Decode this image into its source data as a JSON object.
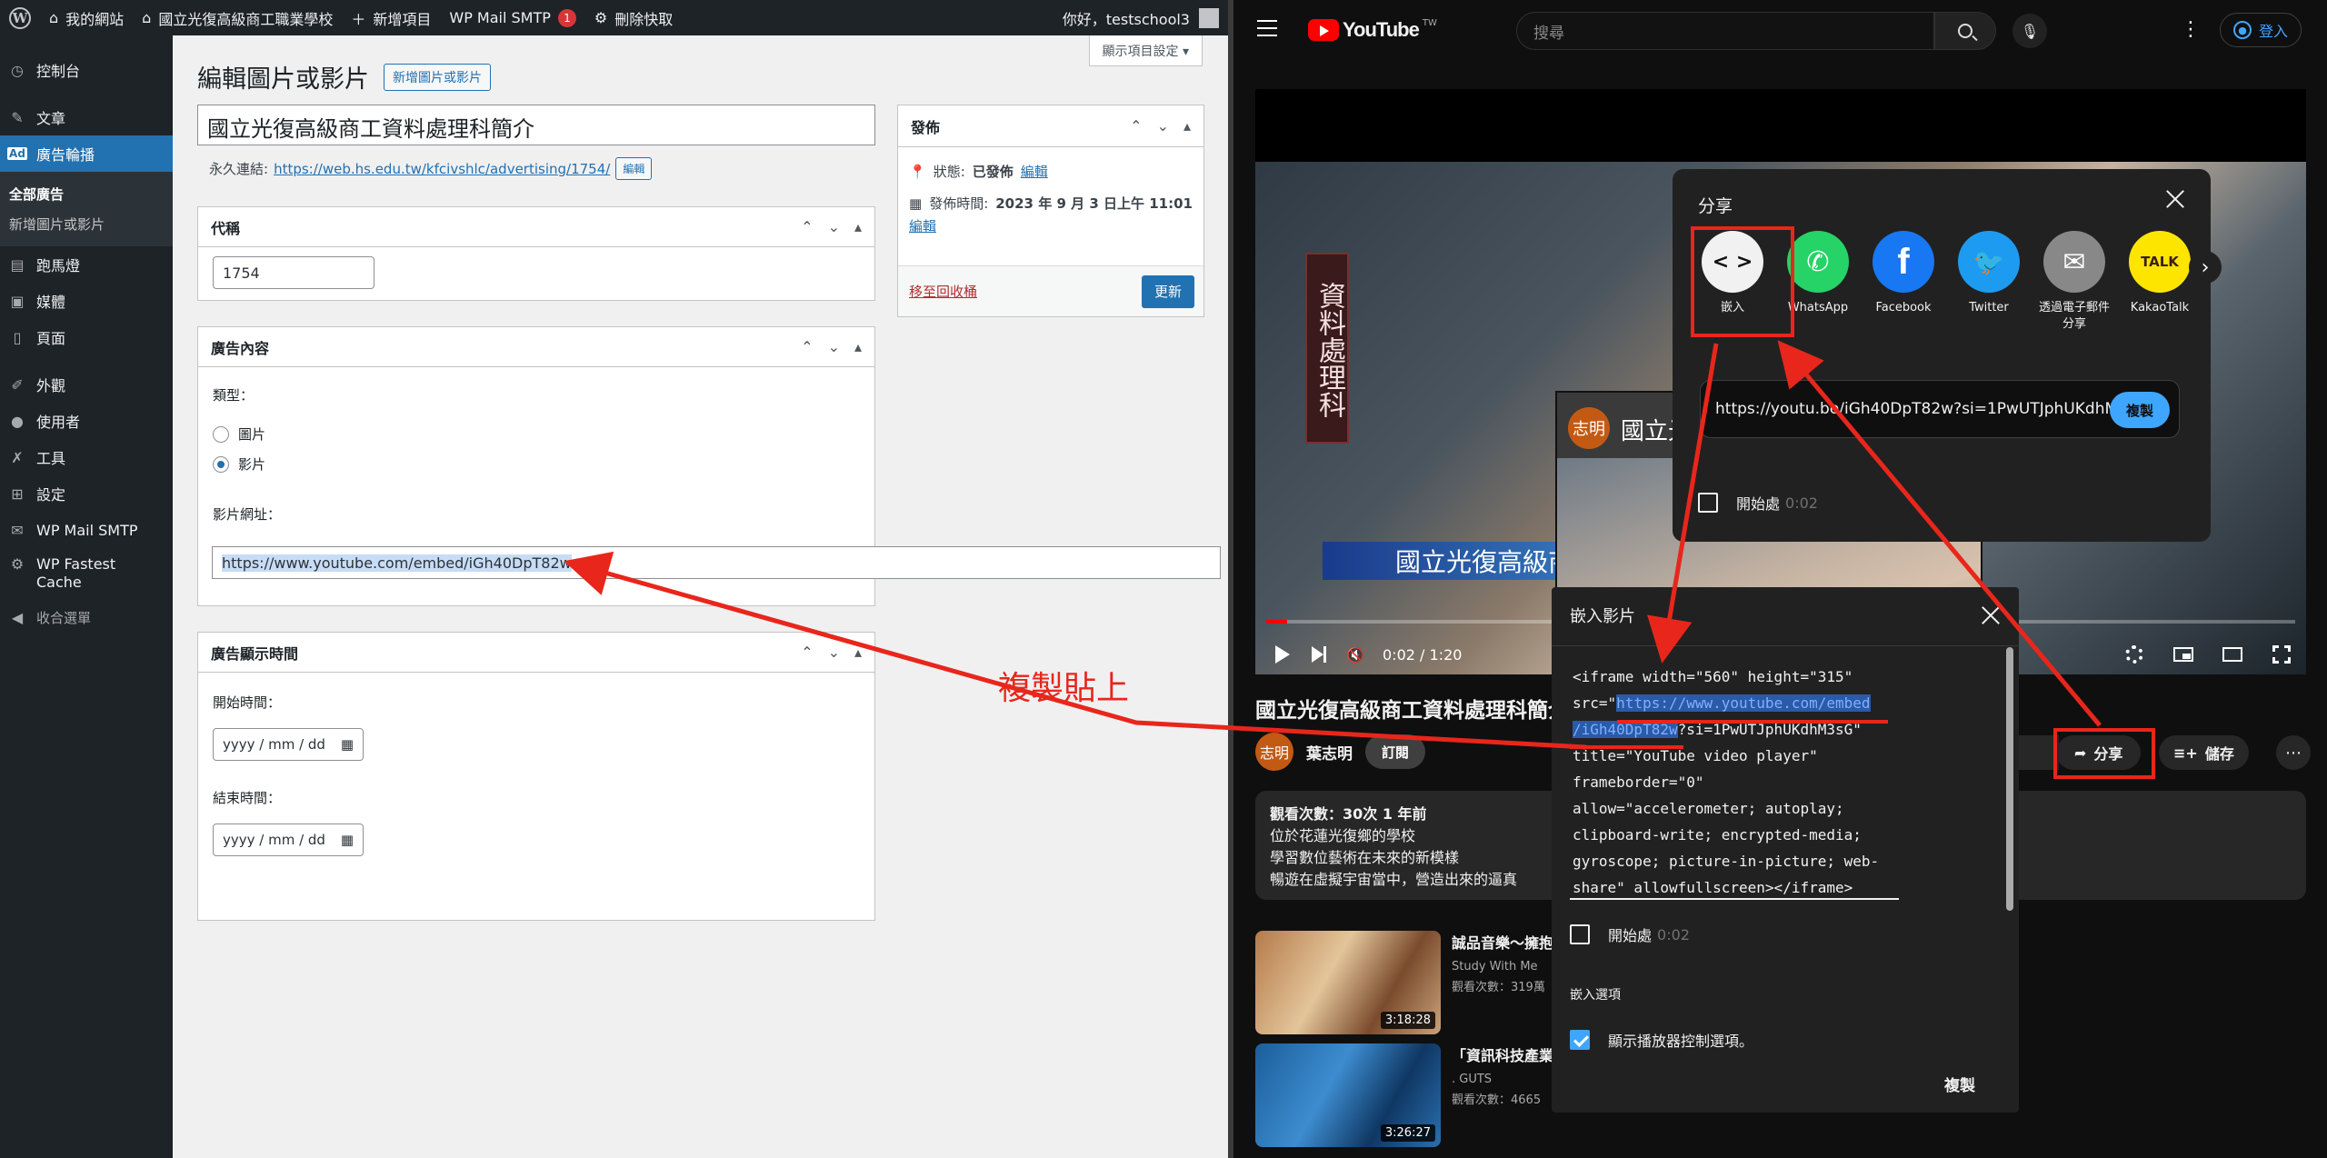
{
  "wp": {
    "adminbar": {
      "wp_logo": "W",
      "site": "我的網站",
      "school": "國立光復高級商工職業學校",
      "new": "新增項目",
      "smtp": "WP Mail SMTP",
      "smtp_count": "1",
      "cache": "刪除快取",
      "greeting": "你好，testschool3"
    },
    "sidebar": {
      "dashboard": "控制台",
      "posts": "文章",
      "ads_icon": "Ad",
      "ads": "廣告輪播",
      "all_ads": "全部廣告",
      "new_ad": "新增圖片或影片",
      "marquee": "跑馬燈",
      "media": "媒體",
      "pages": "頁面",
      "appearance": "外觀",
      "users": "使用者",
      "tools": "工具",
      "settings": "設定",
      "mail_smtp": "WP Mail SMTP",
      "fastest_cache": "WP Fastest Cache",
      "collapse": "收合選單"
    },
    "screen_options": "顯示項目設定 ▾",
    "page_title": "編輯圖片或影片",
    "add_new": "新增圖片或影片",
    "title_value": "國立光復高級商工資料處理科簡介",
    "permalink_label": "永久連結:",
    "permalink_url": "https://web.hs.edu.tw/kfcivshlc/advertising/1754/",
    "edit_btn": "編輯",
    "code_box": {
      "title": "代稱",
      "value": "1754"
    },
    "content_box": {
      "title": "廣告內容",
      "type_label": "類型：",
      "opt_image": "圖片",
      "opt_video": "影片",
      "url_label": "影片網址：",
      "url_value": "https://www.youtube.com/embed/iGh40DpT82w"
    },
    "time_box": {
      "title": "廣告顯示時間",
      "start_label": "開始時間：",
      "end_label": "結束時間：",
      "date_placeholder": "yyyy / mm / dd"
    },
    "publish_box": {
      "title": "發佈",
      "status_label": "狀態: ",
      "status_value": "已發佈",
      "status_edit": "編輯",
      "date_label": "發佈時間: ",
      "date_value": "2023 年 9 月 3 日上午 11:01",
      "date_edit": "編輯",
      "trash": "移至回收桶",
      "update": "更新"
    }
  },
  "yt": {
    "logo": "YouTube",
    "logo_tw": "TW",
    "search_placeholder": "搜尋",
    "signin": "登入",
    "video": {
      "banner": "資料處理科",
      "school_overlay": "國立光復高級商工職業",
      "inner_channel_avatar": "志明",
      "inner_title": "國立光",
      "time": "0:02 / 1:20",
      "progress": 0.02
    },
    "title": "國立光復高級商工資料處理科簡介",
    "channel_avatar": "志明",
    "channel": "葉志明",
    "subscribe": "訂閱",
    "share": "分享",
    "save": "儲存",
    "description": [
      "觀看次數：30次 1 年前",
      "位於花蓮光復鄉的學校",
      "學習數位藝術在未來的新模樣",
      "暢遊在虛擬宇宙當中，營造出來的逼真"
    ],
    "recommendations": [
      {
        "title": "誠品音樂～擁抱",
        "channel": "Study With Me",
        "views": "觀看次數：319萬",
        "duration": "3:18:28"
      },
      {
        "title": "「資訊科技產業",
        "channel": ". GUTS",
        "views": "觀看次數：4665",
        "duration": "3:26:27"
      }
    ],
    "share_dialog": {
      "title": "分享",
      "targets": [
        {
          "label": "嵌入",
          "glyph": "< >"
        },
        {
          "label": "WhatsApp",
          "glyph": "✆"
        },
        {
          "label": "Facebook",
          "glyph": "f"
        },
        {
          "label": "Twitter",
          "glyph": "🐦"
        },
        {
          "label": "透過電子郵件分享",
          "glyph": "✉"
        },
        {
          "label": "KakaoTalk",
          "glyph": "TALK"
        }
      ],
      "next": "›",
      "url": "https://youtu.be/iGh40DpT82w?si=1PwUTJphUKdhM3sG",
      "copy": "複製",
      "start_label": "開始處",
      "start_time": "0:02"
    },
    "embed_dialog": {
      "title": "嵌入影片",
      "code_l1": "<iframe width=\"560\" height=\"315\"",
      "code_l2_pre": "src=\"",
      "code_l2_hl": "https://www.youtube.com/embed",
      "code_l3_hl": "/iGh40DpT82w",
      "code_l3_post": "?si=1PwUTJphUKdhM3sG\"",
      "code_l4": "title=\"YouTube video player\"",
      "code_l5": "frameborder=\"0\"",
      "code_l6": "allow=\"accelerometer; autoplay;",
      "code_l7": "clipboard-write; encrypted-media;",
      "code_l8": "gyroscope; picture-in-picture; web-",
      "code_l9": "share\" allowfullscreen></iframe>",
      "start_label": "開始處",
      "start_time": "0:02",
      "options_heading": "嵌入選項",
      "option_controls": "顯示播放器控制選項。",
      "copy": "複製"
    }
  },
  "annotation": {
    "note": "複製貼上",
    "color": "#e8261b"
  }
}
